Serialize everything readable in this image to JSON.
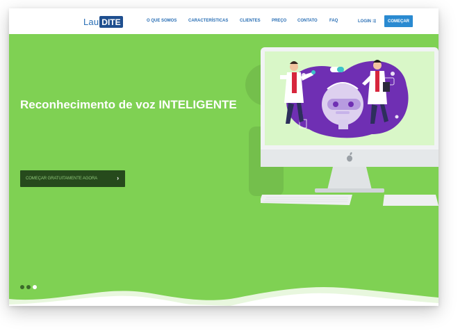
{
  "nav": {
    "logo_part1": "Lau",
    "logo_part2": "DITE",
    "links": [
      "O QUE SOMOS",
      "CARACTERÍSTICAS",
      "CLIENTES",
      "PREÇO",
      "CONTATO",
      "FAQ"
    ],
    "login": "LOGIN",
    "login_icon": "⇶",
    "start": "COMEÇAR"
  },
  "hero": {
    "title": "Reconhecimento de voz INTELIGENTE",
    "cta": "COMEÇAR GRATUITAMENTE AGORA",
    "cta_arrow": "›",
    "slides_total": 3,
    "active_slide": 3
  },
  "colors": {
    "hero_bg": "#7fd153",
    "nav_text": "#2a6fb5",
    "button_blue": "#2a8ad1",
    "cta_bg": "#264a1c",
    "illustration_purple": "#6f2fb3"
  }
}
